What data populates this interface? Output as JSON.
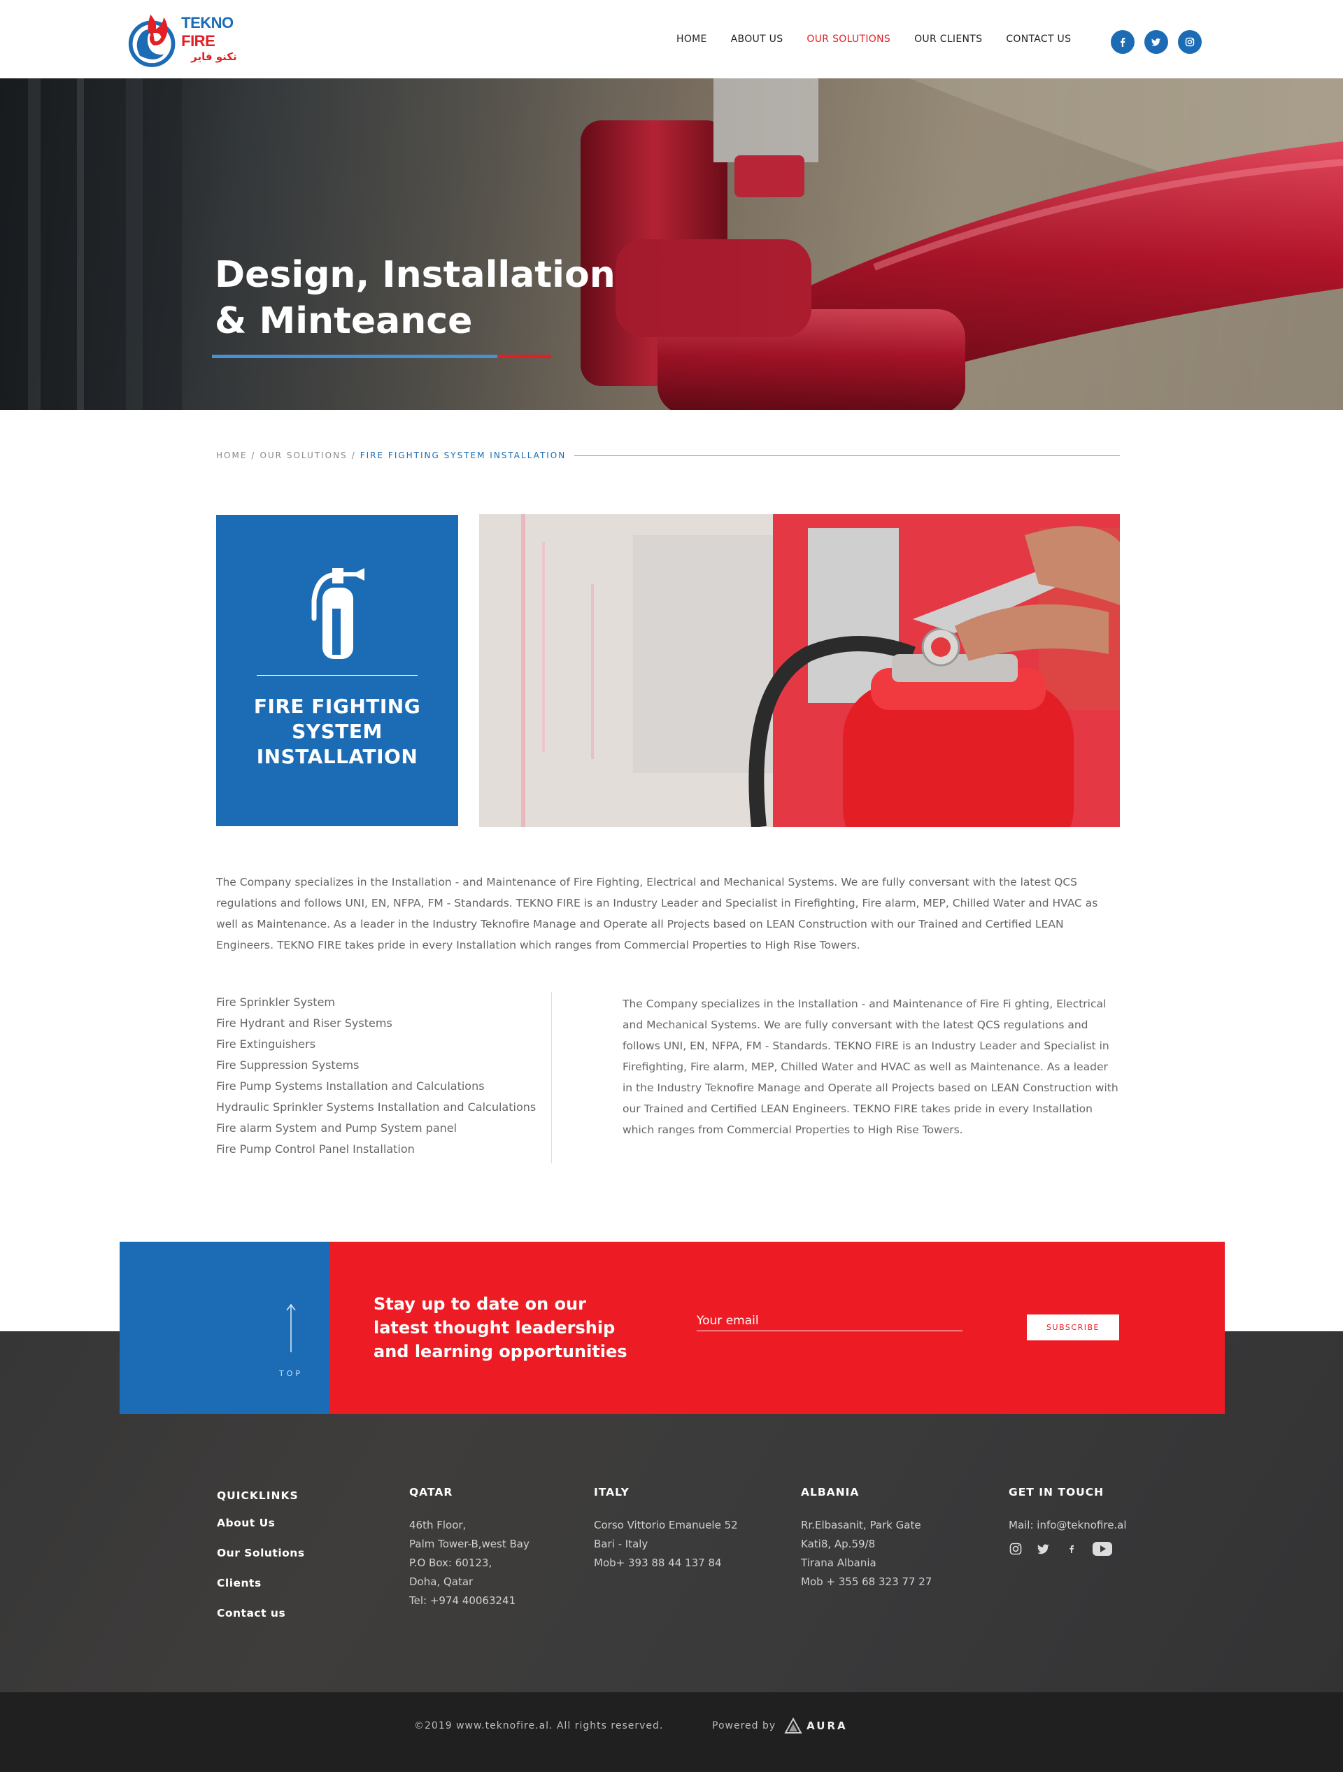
{
  "brand": {
    "name_en_part1": "TEKNO",
    "name_en_part2": "FIRE",
    "name_ar": "تكنو فاير",
    "primary_color": "#1b6cb5",
    "accent_color": "#e31e24"
  },
  "nav": {
    "items": [
      "HOME",
      "ABOUT US",
      "OUR SOLUTIONS",
      "OUR CLIENTS",
      "CONTACT US"
    ],
    "active": "OUR SOLUTIONS"
  },
  "header_social": [
    "facebook-icon",
    "twitter-icon",
    "instagram-icon"
  ],
  "hero": {
    "title_line1": "Design, Installation",
    "title_line2": "& Minteance"
  },
  "breadcrumb": {
    "home": "HOME",
    "sep": "/",
    "section": "OUR SOLUTIONS",
    "current": "FIRE FIGHTING SYSTEM INSTALLATION"
  },
  "feature": {
    "title_line1": "FIRE FIGHTING",
    "title_line2": "SYSTEM",
    "title_line3": "INSTALLATION",
    "icon": "fire-extinguisher-icon"
  },
  "intro": "The Company specializes in the Installation - and Maintenance of Fire Fighting, Electrical and Mechanical Systems. We are fully conversant with the latest QCS regulations and follows UNI, EN, NFPA, FM - Standards. TEKNO FIRE is an Industry Leader and Specialist in Firefighting, Fire alarm, MEP, Chilled Water and HVAC as well as Maintenance. As a leader in the Industry Teknofire Manage and Operate all Projects based on LEAN Construction with our Trained and Certified LEAN Engineers. TEKNO FIRE takes pride in every Installation which ranges from Commercial Properties to High Rise Towers.",
  "services": [
    "Fire Sprinkler System",
    "Fire Hydrant and Riser Systems",
    "Fire Extinguishers",
    "Fire Suppression Systems",
    "Fire Pump Systems Installation and Calculations",
    "Hydraulic Sprinkler Systems Installation and Calculations",
    "Fire alarm System and Pump System panel",
    "Fire Pump Control Panel Installation"
  ],
  "right_text": "The Company specializes in the Installation - and Maintenance of Fire Fi ghting, Electrical and Mechanical Systems. We are fully conversant with the latest QCS regulations and follows UNI, EN, NFPA, FM - Standards. TEKNO FIRE is an Industry Leader and Specialist in Firefighting, Fire alarm, MEP, Chilled Water and HVAC as well as Maintenance. As a leader in the Industry Teknofire Manage and Operate all Projects based on LEAN Construction with our Trained and Certified LEAN Engineers. TEKNO FIRE takes pride in every Installation which ranges from Commercial Properties to High Rise Towers.",
  "newsletter": {
    "top_label": "TOP",
    "headline": "Stay up to date on our latest thought leadership and learning opportunities",
    "email_placeholder": "Your email",
    "subscribe_label": "SUBSCRIBE"
  },
  "footer": {
    "quicklinks": {
      "title": "QUICKLINKS",
      "links": [
        "About Us",
        "Our Solutions",
        "Clients",
        "Contact us"
      ]
    },
    "qatar": {
      "title": "QATAR",
      "lines": [
        "46th Floor,",
        "Palm Tower-B,west Bay",
        "P.O Box: 60123,",
        "Doha, Qatar",
        "Tel: +974 40063241"
      ]
    },
    "italy": {
      "title": "ITALY",
      "lines": [
        "Corso Vittorio Emanuele 52",
        "Bari - Italy",
        "Mob+ 393 88 44 137 84"
      ]
    },
    "albania": {
      "title": "ALBANIA",
      "lines": [
        "Rr.Elbasanit, Park Gate",
        "Kati8, Ap.59/8",
        "Tirana Albania",
        "Mob + 355 68 323 77 27"
      ]
    },
    "contact": {
      "title": "GET IN TOUCH",
      "mail": "Mail: info@teknofire.al",
      "social": [
        "instagram-icon",
        "twitter-icon",
        "facebook-icon",
        "youtube-icon"
      ]
    },
    "copyright": "©2019 www.teknofire.al. All rights reserved.",
    "powered_by": "Powered by",
    "powered_brand": "AURA"
  }
}
